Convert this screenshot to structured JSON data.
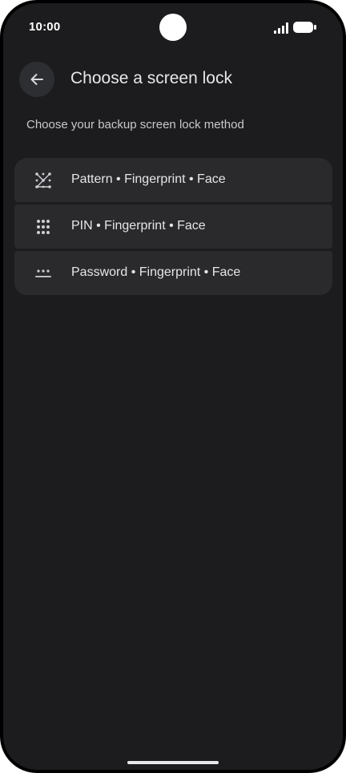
{
  "status_bar": {
    "time": "10:00",
    "signal_icon": "cellular-signal-icon",
    "battery_icon": "battery-full-icon"
  },
  "header": {
    "back_icon": "arrow-left-icon",
    "title": "Choose a screen lock"
  },
  "subtitle": "Choose your backup screen lock method",
  "options": [
    {
      "icon": "pattern-icon",
      "label": "Pattern • Fingerprint • Face"
    },
    {
      "icon": "pin-keypad-icon",
      "label": "PIN • Fingerprint • Face"
    },
    {
      "icon": "password-icon",
      "label": "Password • Fingerprint • Face"
    }
  ],
  "colors": {
    "background": "#1c1c1e",
    "card": "#2a2a2d",
    "text_primary": "#e8e8ea",
    "text_secondary": "#c8c8cc"
  }
}
